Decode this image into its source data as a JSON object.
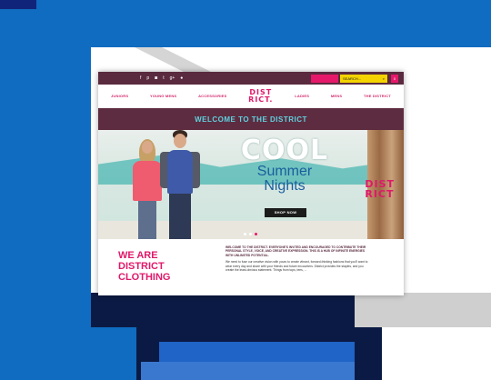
{
  "topbar": {
    "social_icons": [
      "facebook-icon",
      "pinterest-icon",
      "instagram-icon",
      "twitter-icon",
      "google-plus-icon",
      "user-icon"
    ],
    "social_glyphs": [
      "f",
      "p",
      "◙",
      "t",
      "g+",
      "●"
    ],
    "search_placeholder": "SEARCH...",
    "cart_label": "0"
  },
  "nav": {
    "items": [
      "JUNIORS",
      "YOUNG MENS",
      "ACCESSORIES",
      "LADIES",
      "MENS",
      "THE DISTRICT"
    ],
    "logo_line1": "DIST",
    "logo_line2": "RICT."
  },
  "welcome": {
    "title": "WELCOME TO THE DISTRICT"
  },
  "hero": {
    "headline": "COOL",
    "line2": "Summer",
    "line3": "Nights",
    "button": "SHOP NOW",
    "logo_line1": "DIST",
    "logo_line2": "RICT"
  },
  "about": {
    "heading": "WE ARE DISTRICT CLOTHING",
    "intro": "WELCOME TO THE DISTRICT. EVERYONE'S INVITED AND ENCOURAGED TO CONTRIBUTE THEIR PERSONAL STYLE, VOICE, AND CREATIVE EXPRESSION. THIS IS A HUB OF INFINITE ENERGIES WITH UNLIMITED POTENTIAL.",
    "body": "We need to fuse our creative vision with yours to create vibrant, forward-thinking fashions that you'll want to wear every day and share with your friends and future encounters. District provides the staples, and you create the least-obvious statement. Things from tops, tees, ..."
  },
  "colors": {
    "brand_pink": "#e0186a",
    "brand_plum": "#5a2a3e",
    "accent_teal": "#5fd2e0",
    "page_blue": "#0f6cc0",
    "navy": "#0b1a44"
  }
}
